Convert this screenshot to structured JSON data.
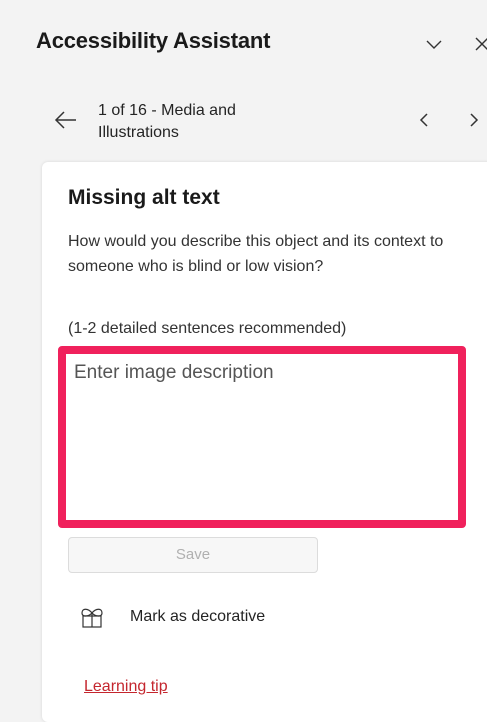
{
  "pane": {
    "title": "Accessibility Assistant"
  },
  "navigation": {
    "position_text": "1 of 16 - Media and Illustrations"
  },
  "issue": {
    "title": "Missing alt text",
    "description": "How would you describe this object and its context to someone who is blind or low vision?",
    "hint": "(1-2 detailed sentences recommended)",
    "input_value": "",
    "input_placeholder": "Enter image description",
    "save_label": "Save",
    "mark_decorative_label": "Mark as decorative",
    "learning_tip_label": "Learning tip"
  },
  "icons": {
    "collapse": "chevron-down-icon",
    "close": "close-icon",
    "back": "arrow-left-icon",
    "previous": "chevron-left-icon",
    "next": "chevron-right-icon",
    "decorative": "bow-icon"
  },
  "colors": {
    "highlight_border": "#f0215c",
    "link": "#c4262e",
    "pane_background": "#f3f3f3",
    "card_background": "#ffffff"
  }
}
